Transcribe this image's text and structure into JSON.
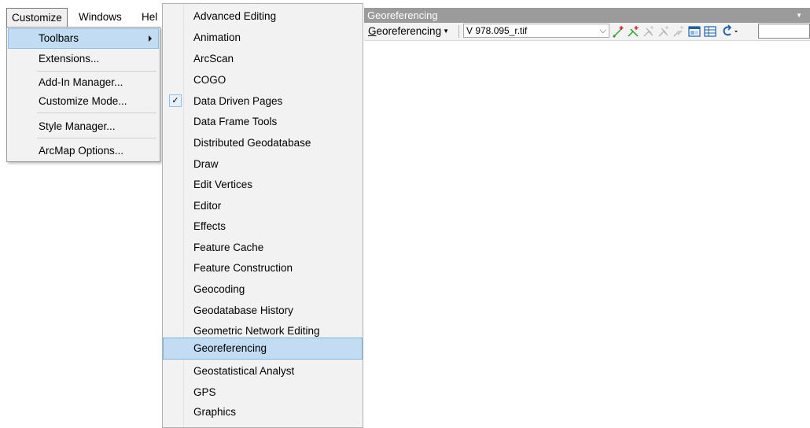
{
  "menubar": {
    "items": [
      {
        "label": "Customize"
      },
      {
        "label": "Windows"
      },
      {
        "label": "Hel"
      }
    ]
  },
  "customize_menu": {
    "items": [
      {
        "label": "Toolbars",
        "highlighted": true,
        "has_submenu": true
      },
      {
        "label": "Extensions..."
      },
      {
        "label": "Add-In Manager..."
      },
      {
        "label": "Customize Mode..."
      },
      {
        "label": "Style Manager..."
      },
      {
        "label": "ArcMap Options..."
      }
    ]
  },
  "toolbars_menu": {
    "items": [
      {
        "label": "Advanced Editing"
      },
      {
        "label": "Animation"
      },
      {
        "label": "ArcScan"
      },
      {
        "label": "COGO"
      },
      {
        "label": "Data Driven Pages",
        "checked": true
      },
      {
        "label": "Data Frame Tools"
      },
      {
        "label": "Distributed Geodatabase"
      },
      {
        "label": "Draw"
      },
      {
        "label": "Edit Vertices"
      },
      {
        "label": "Editor"
      },
      {
        "label": "Effects"
      },
      {
        "label": "Feature Cache"
      },
      {
        "label": "Feature Construction"
      },
      {
        "label": "Geocoding"
      },
      {
        "label": "Geodatabase History"
      },
      {
        "label": "Geometric Network Editing"
      },
      {
        "label": "Georeferencing",
        "highlighted": true
      },
      {
        "label": "Geostatistical Analyst"
      },
      {
        "label": "GPS"
      },
      {
        "label": "Graphics"
      }
    ]
  },
  "geo_window": {
    "title": "Georeferencing",
    "menu_first_letter": "G",
    "menu_rest": "eoreferencing",
    "layer_value": "V 978.095_r.tif",
    "tools": [
      {
        "icon": "add-control-points-icon"
      },
      {
        "icon": "auto-registration-icon"
      },
      {
        "icon": "select-link-icon"
      },
      {
        "icon": "zoom-to-selected-link-icon"
      },
      {
        "icon": "delete-link-icon"
      },
      {
        "icon": "viewer-icon"
      },
      {
        "icon": "view-link-table-icon"
      },
      {
        "icon": "rotate-icon"
      }
    ]
  },
  "colors": {
    "highlight": "#c1dcf3",
    "title_bar": "#9b9b9b",
    "menu_bg": "#f2f2f2"
  }
}
